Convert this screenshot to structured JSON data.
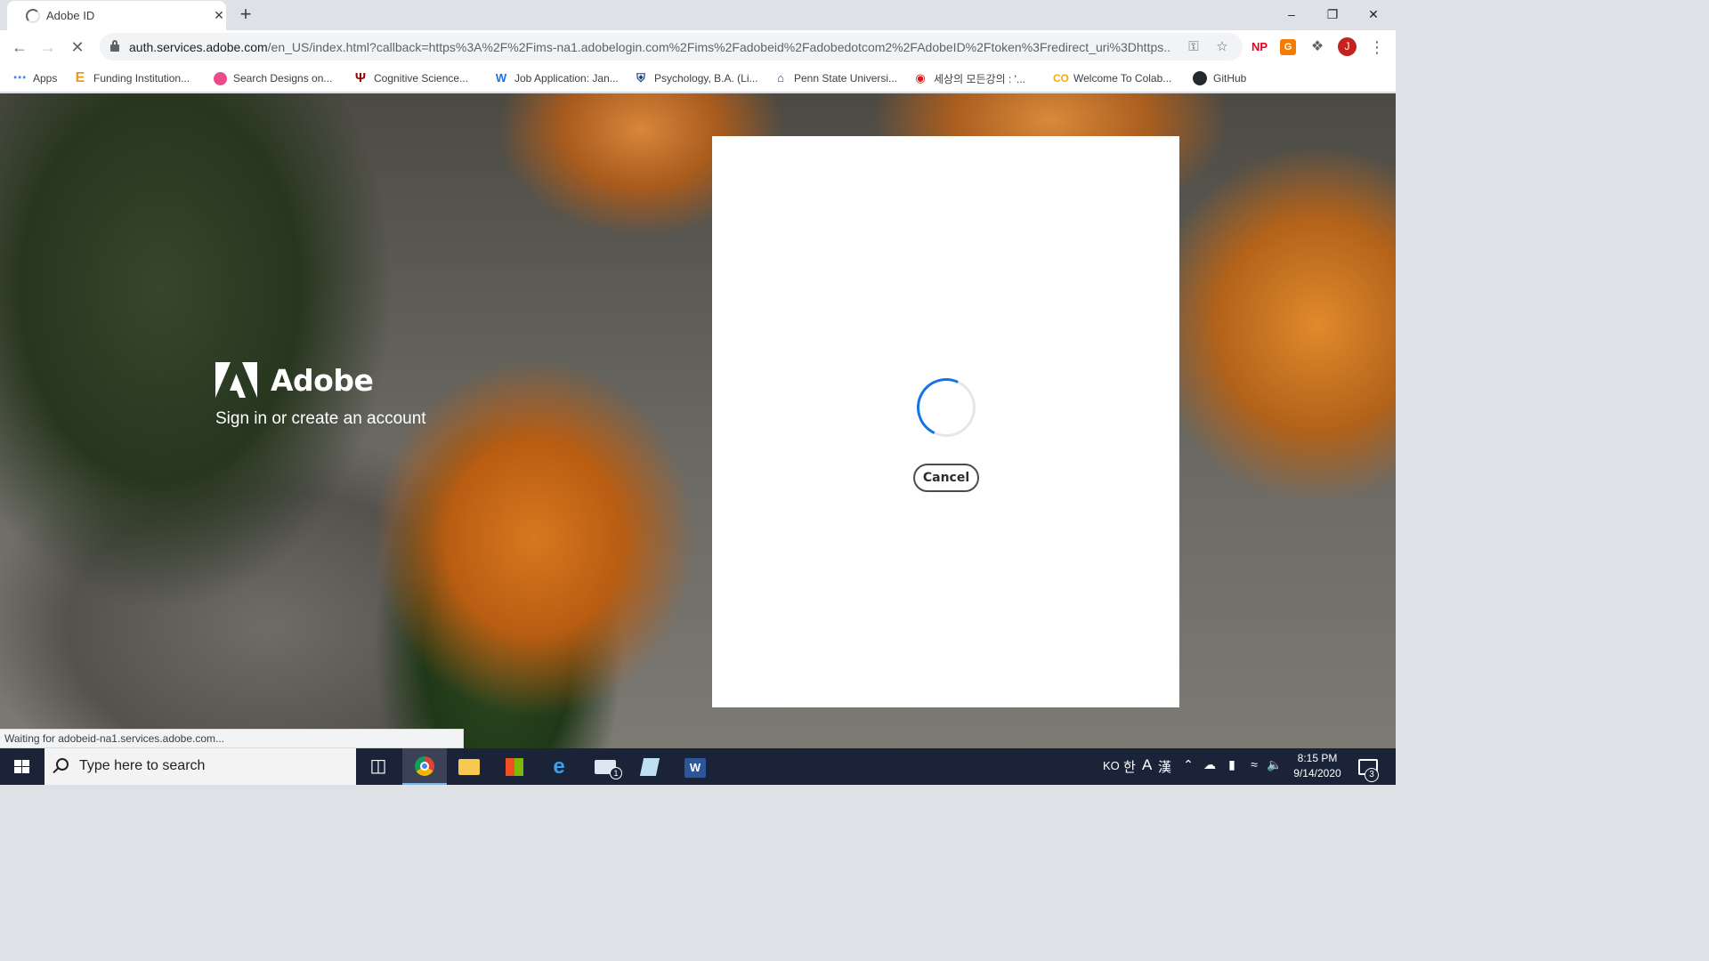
{
  "browser": {
    "tab_title": "Adobe ID",
    "url_host": "auth.services.adobe.com",
    "url_path": "/en_US/index.html?callback=https%3A%2F%2Fims-na1.adobelogin.com%2Fims%2Fadobeid%2Fadobedotcom2%2FAdobeID%2Ftoken%3Fredirect_uri%3Dhttps...",
    "profile_initial": "J",
    "extensions": [
      "NP"
    ],
    "status_text": "Waiting for adobeid-na1.services.adobe.com..."
  },
  "bookmarks": [
    {
      "label": "Apps",
      "icon": "apps-grid-icon"
    },
    {
      "label": "Funding Institution...",
      "icon": "e-icon"
    },
    {
      "label": "Search Designs on...",
      "icon": "dribbble-icon"
    },
    {
      "label": "Cognitive Science...",
      "icon": "iu-icon"
    },
    {
      "label": "Job Application: Jan...",
      "icon": "w-icon"
    },
    {
      "label": "Psychology, B.A. (Li...",
      "icon": "shield-icon"
    },
    {
      "label": "Penn State Universi...",
      "icon": "house-icon"
    },
    {
      "label": "세상의 모든강의 : '...",
      "icon": "korean-site-icon"
    },
    {
      "label": "Welcome To Colab...",
      "icon": "colab-icon"
    },
    {
      "label": "GitHub",
      "icon": "github-icon"
    }
  ],
  "page": {
    "brand_name": "Adobe",
    "tagline": "Sign in or create an account",
    "cancel_label": "Cancel"
  },
  "taskbar": {
    "search_placeholder": "Type here to search",
    "lang": "KO",
    "ime_hangul": "한",
    "ime_mode": "A",
    "ime_hanja": "漢",
    "time": "8:15 PM",
    "date": "9/14/2020",
    "mail_badge": "1",
    "notification_count": "3"
  },
  "colors": {
    "accent_blue": "#1473e6",
    "taskbar": "#1b2339"
  }
}
